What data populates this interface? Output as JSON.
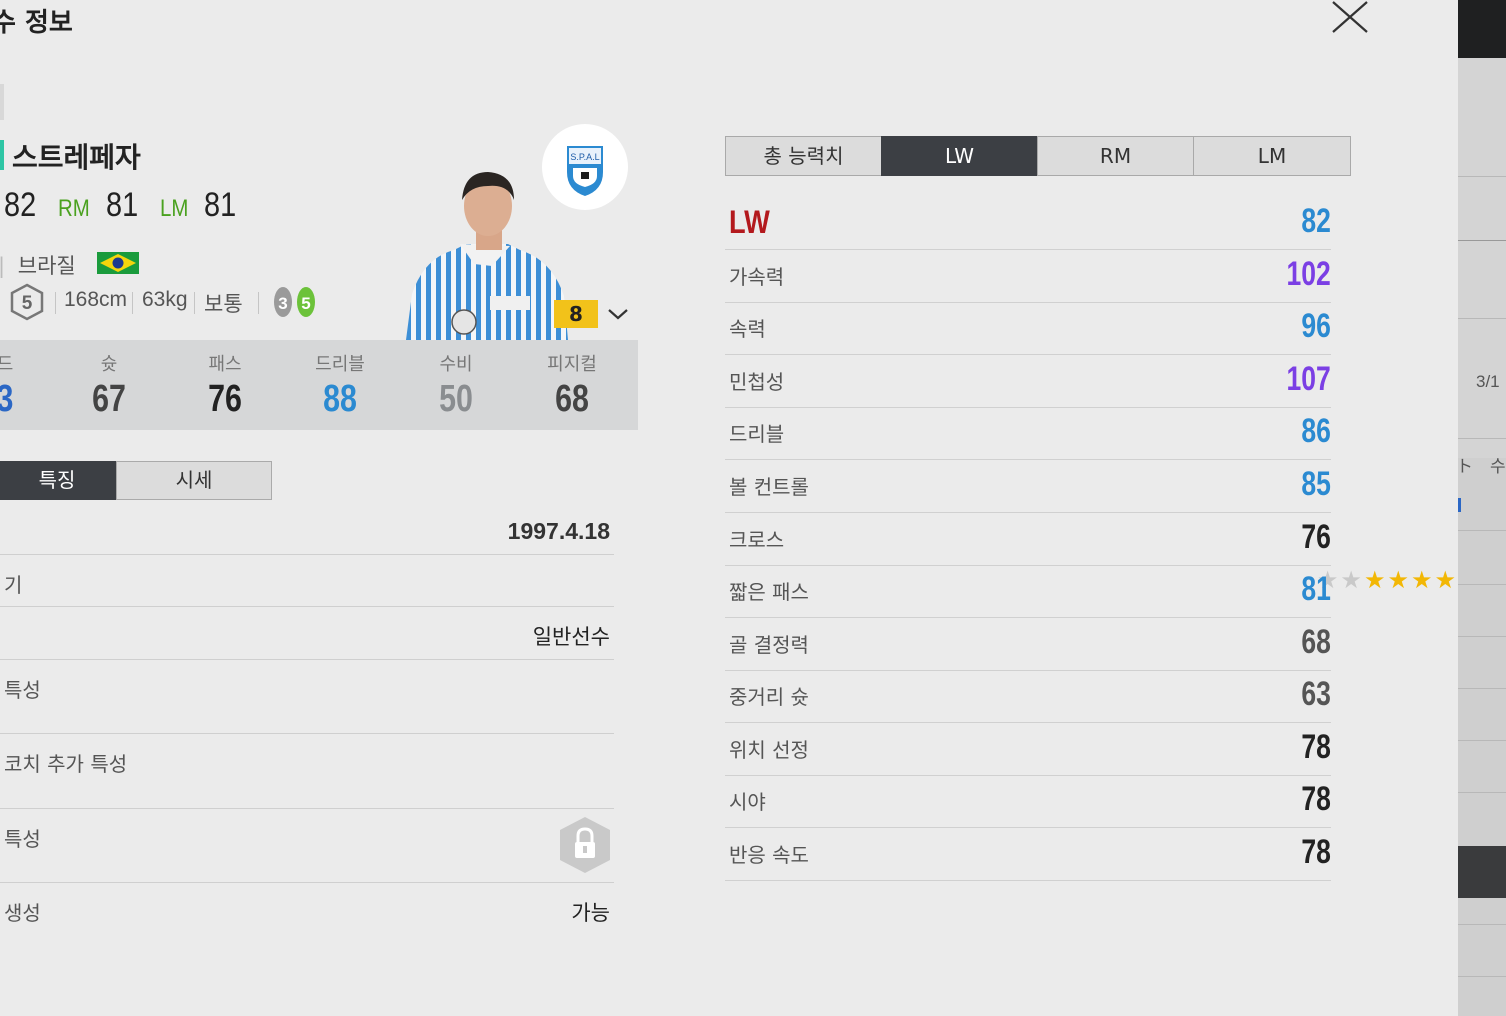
{
  "window": {
    "title": "수 정보",
    "close_icon": "close-icon"
  },
  "player": {
    "name": "스트레페자",
    "positions": [
      {
        "label": "",
        "value": "82"
      },
      {
        "label": "RM",
        "value": "81"
      },
      {
        "label": "LM",
        "value": "81"
      }
    ],
    "nation_prefix": "|",
    "nation": "브라질",
    "foot_badge": "5",
    "height": "168cm",
    "weight": "63kg",
    "body_type": "보통",
    "skill_left": "3",
    "skill_right": "5",
    "enhance_level": "8",
    "club_badge_text": "S.P.A.L"
  },
  "summary_stats": [
    {
      "label": "드",
      "value": "3",
      "color": "#2b67c5"
    },
    {
      "label": "슛",
      "value": "67",
      "color": "#444444"
    },
    {
      "label": "패스",
      "value": "76",
      "color": "#222222"
    },
    {
      "label": "드리블",
      "value": "88",
      "color": "#2b8ad1"
    },
    {
      "label": "수비",
      "value": "50",
      "color": "#8a8d90"
    },
    {
      "label": "피지컬",
      "value": "68",
      "color": "#444444"
    }
  ],
  "left_tabs": [
    {
      "label": "특징",
      "active": true
    },
    {
      "label": "시세",
      "active": false
    }
  ],
  "info": {
    "birth": "1997.4.18",
    "row2_label": "기",
    "stars_filled": 4,
    "stars_total": 6,
    "row3_value": "일반선수",
    "row4_label": "특성",
    "row5_label": "코치 추가 특성",
    "row6_label": "특성",
    "lock_icon": "lock-icon",
    "row7_label": "생성",
    "row7_value": "가능"
  },
  "right_tabs": [
    {
      "label": "총 능력치",
      "active": false
    },
    {
      "label": "LW",
      "active": true
    },
    {
      "label": "RM",
      "active": false
    },
    {
      "label": "LM",
      "active": false
    }
  ],
  "position_detail": {
    "position": "LW",
    "ovr": "82",
    "stats": [
      {
        "name": "가속력",
        "value": "102",
        "color": "#7b3fe4"
      },
      {
        "name": "속력",
        "value": "96",
        "color": "#2b8ad1"
      },
      {
        "name": "민첩성",
        "value": "107",
        "color": "#7b3fe4"
      },
      {
        "name": "드리블",
        "value": "86",
        "color": "#2b8ad1"
      },
      {
        "name": "볼 컨트롤",
        "value": "85",
        "color": "#2b8ad1"
      },
      {
        "name": "크로스",
        "value": "76",
        "color": "#222222"
      },
      {
        "name": "짧은 패스",
        "value": "81",
        "color": "#2b8ad1"
      },
      {
        "name": "골 결정력",
        "value": "68",
        "color": "#555555"
      },
      {
        "name": "중거리 슛",
        "value": "63",
        "color": "#555555"
      },
      {
        "name": "위치 선정",
        "value": "78",
        "color": "#222222"
      },
      {
        "name": "시야",
        "value": "78",
        "color": "#222222"
      },
      {
        "name": "반응 속도",
        "value": "78",
        "color": "#222222"
      }
    ]
  },
  "background": {
    "page_indicator": "3/1",
    "partial_text_1": "ト",
    "partial_text_2": "수"
  },
  "colors": {
    "accent_green": "#2dc5a4",
    "position_green": "#4aa11f",
    "tab_active": "#3c3f44",
    "position_red": "#b3191d",
    "level_badge": "#f2c21a"
  }
}
